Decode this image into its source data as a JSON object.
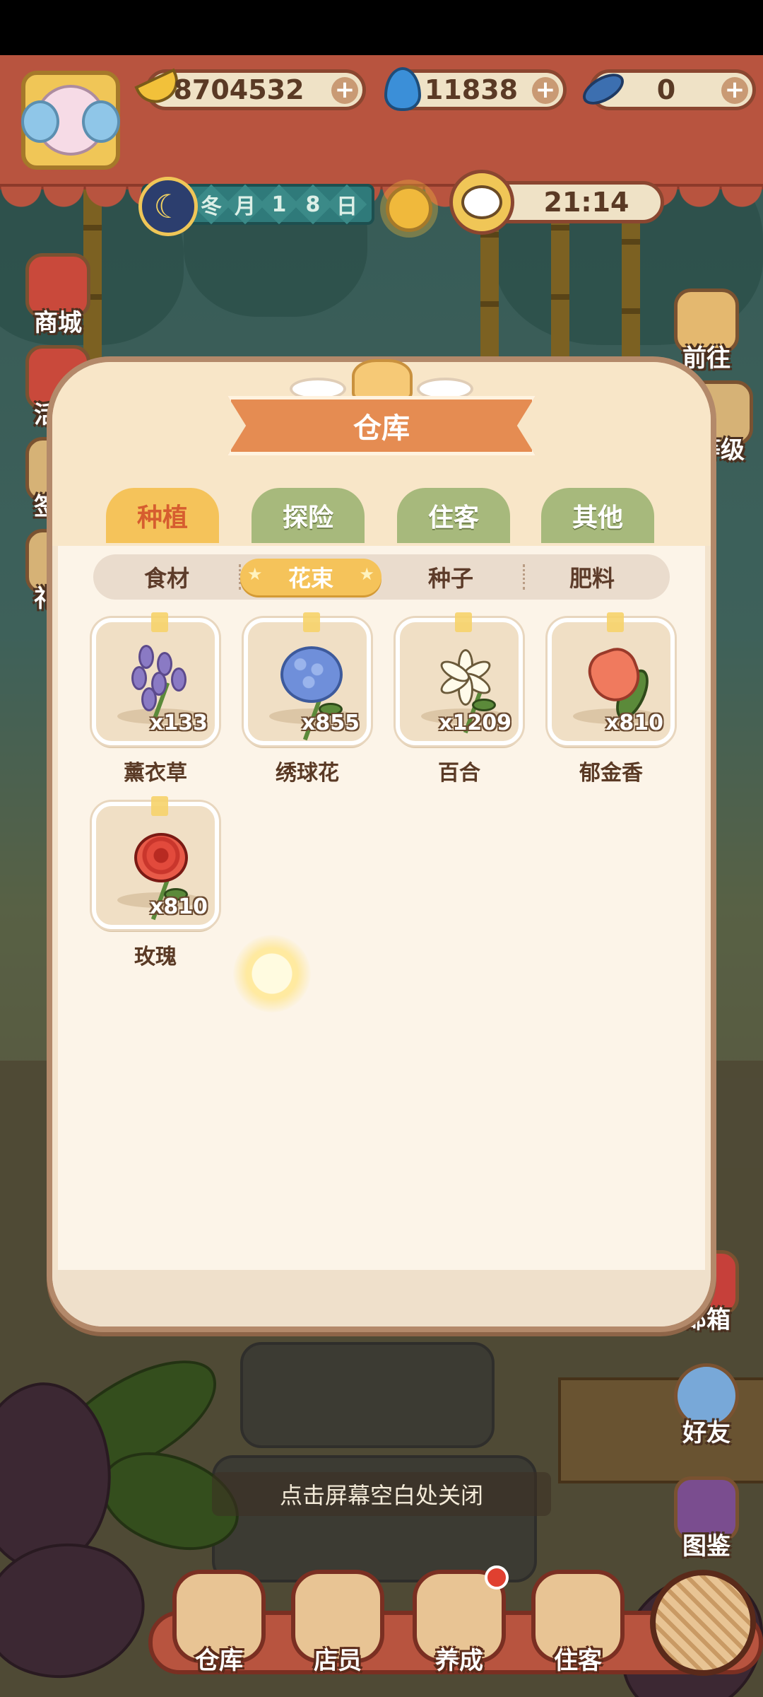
{
  "hud": {
    "bananas": "8704532",
    "fire": "11838",
    "fish": "0",
    "date_chars": [
      "冬",
      "月",
      "1",
      "8",
      "日"
    ],
    "time": "21:14"
  },
  "side_left": [
    {
      "label": "商城"
    },
    {
      "label": "活动"
    },
    {
      "label": "签到"
    },
    {
      "label": "礼包"
    }
  ],
  "side_right": {
    "goto": "前往",
    "level": "等级",
    "mail": "邮箱",
    "friends": "好友",
    "codex": "图鉴"
  },
  "modal": {
    "title": "仓库",
    "tabs": [
      "种植",
      "探险",
      "住客",
      "其他"
    ],
    "active_tab": "种植",
    "subtabs": [
      "食材",
      "花束",
      "种子",
      "肥料"
    ],
    "active_subtab": "花束",
    "items": [
      {
        "name": "薰衣草",
        "qty": "x133"
      },
      {
        "name": "绣球花",
        "qty": "x855"
      },
      {
        "name": "百合",
        "qty": "x1209"
      },
      {
        "name": "郁金香",
        "qty": "x810"
      },
      {
        "name": "玫瑰",
        "qty": "x810"
      }
    ]
  },
  "close_hint": "点击屏幕空白处关闭",
  "bottom_nav": [
    "仓库",
    "店员",
    "养成",
    "住客"
  ],
  "colors": {
    "hud_red": "#b8543f",
    "tab_active": "#f5c35a",
    "tab_inactive": "#a7b97c",
    "ribbon": "#e58c52",
    "panel": "#fcf4e8"
  }
}
